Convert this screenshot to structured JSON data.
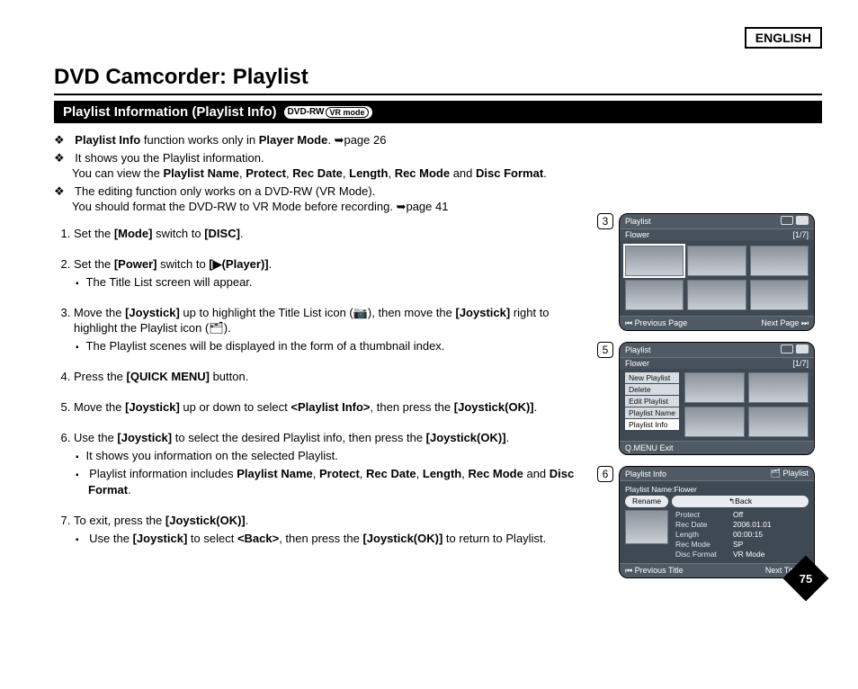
{
  "header": {
    "language": "ENGLISH",
    "title": "DVD Camcorder: Playlist",
    "section": "Playlist Information (Playlist Info)",
    "badge_prefix": "DVD-RW",
    "badge_mode": "VR mode"
  },
  "intro": [
    {
      "type": "bold-run",
      "pre": "",
      "b1": "Playlist Info",
      "mid": " function works only in ",
      "b2": "Player Mode",
      "post": ". ➥page 26"
    },
    {
      "type": "plain",
      "text": "It shows you the Playlist information."
    },
    {
      "type": "fields",
      "pre": "You can view the ",
      "fields": [
        "Playlist Name",
        "Protect",
        "Rec Date",
        "Length",
        "Rec Mode",
        "Disc Format"
      ],
      "post": ".",
      "indent": true
    },
    {
      "type": "plain",
      "text": "The editing function only works on a DVD-RW (VR Mode)."
    },
    {
      "type": "plain",
      "text": "You should format the DVD-RW to VR Mode before recording. ➥page 41",
      "indent": true
    }
  ],
  "steps": [
    {
      "n": 1,
      "parts": [
        "Set the ",
        "[Mode]",
        " switch to ",
        "[DISC]",
        "."
      ]
    },
    {
      "n": 2,
      "parts": [
        "Set the ",
        "[Power]",
        " switch to ",
        "[▶(Player)]",
        "."
      ],
      "sub": [
        "The Title List screen will appear."
      ]
    },
    {
      "n": 3,
      "parts": [
        "Move the ",
        "[Joystick]",
        " up to highlight the Title List icon (📷), then move the ",
        "[Joystick]",
        " right to highlight the Playlist icon (🗂)."
      ],
      "sub": [
        "The Playlist scenes will be displayed in the form of a thumbnail index."
      ]
    },
    {
      "n": 4,
      "parts": [
        "Press the ",
        "[QUICK MENU]",
        " button."
      ]
    },
    {
      "n": 5,
      "parts": [
        "Move the ",
        "[Joystick]",
        " up or down to select ",
        "<Playlist Info>",
        ", then press the ",
        "[Joystick(OK)]",
        "."
      ]
    },
    {
      "n": 6,
      "parts": [
        "Use the ",
        "[Joystick]",
        " to select the desired Playlist info, then press the ",
        "[Joystick(OK)]",
        "."
      ],
      "sub": [
        "It shows you information on the selected Playlist.",
        {
          "pre": "Playlist information includes ",
          "fields": [
            "Playlist Name",
            "Protect",
            "Rec Date",
            "Length",
            "Rec Mode"
          ],
          "and": " and ",
          "last": "Disc Format",
          "post": "."
        }
      ]
    },
    {
      "n": 7,
      "parts": [
        "To exit, press the ",
        "[Joystick(OK)]",
        "."
      ],
      "sub": [
        {
          "pre": "Use the ",
          "b1": "[Joystick]",
          "mid": " to select ",
          "b2": "<Back>",
          "mid2": ", then press the ",
          "b3": "[Joystick(OK)]",
          "post": " to return to Playlist."
        }
      ]
    }
  ],
  "figures": {
    "f3": {
      "num": "3",
      "title": "Playlist",
      "name": "Flower",
      "counter": "[1/7]",
      "prev": "⏮ Previous Page",
      "next": "Next Page ⏭"
    },
    "f5": {
      "num": "5",
      "title": "Playlist",
      "name": "Flower",
      "counter": "[1/7]",
      "menu": [
        "New Playlist",
        "Delete",
        "Edit Playlist",
        "Playlist Name",
        "Playlist Info"
      ],
      "exit": "Q.MENU Exit"
    },
    "f6": {
      "num": "6",
      "head_left": "Playlist Info",
      "head_right": "🗂 Playlist",
      "name_label": "Playlist Name:",
      "name_value": "Flower",
      "rename": "Rename",
      "back": "↰Back",
      "rows": [
        {
          "label": "Protect",
          "value": "Off"
        },
        {
          "label": "Rec Date",
          "value": "2006.01.01"
        },
        {
          "label": "Length",
          "value": "00:00:15"
        },
        {
          "label": "Rec Mode",
          "value": "SP"
        },
        {
          "label": "Disc Format",
          "value": "VR Mode"
        }
      ],
      "prev": "⏮ Previous Title",
      "next": "Next Title ⏭"
    }
  },
  "page_number": "75"
}
